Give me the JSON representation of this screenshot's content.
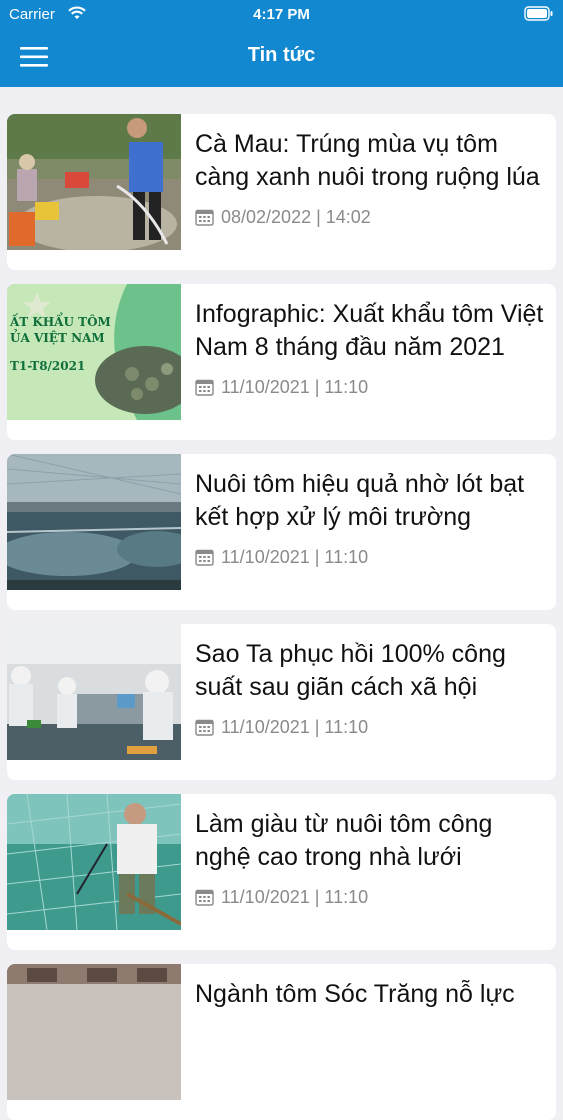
{
  "status_bar": {
    "carrier": "Carrier",
    "time": "4:17 PM"
  },
  "header": {
    "title": "Tin tức"
  },
  "icons": {
    "menu": "hamburger-menu-icon",
    "calendar": "calendar-icon",
    "wifi": "wifi-icon",
    "battery": "battery-icon"
  },
  "colors": {
    "header": "#1188d0",
    "background": "#efeff4",
    "meta_text": "#8a8a8a"
  },
  "articles": [
    {
      "title": "Cà Mau: Trúng mùa vụ tôm càng xanh nuôi trong ruộng lúa",
      "date": "08/02/2022 | 14:02"
    },
    {
      "title": "Infographic: Xuất khẩu tôm Việt Nam 8 tháng đầu năm 2021",
      "date": "11/10/2021 | 11:10"
    },
    {
      "title": "Nuôi tôm hiệu quả nhờ lót bạt kết hợp xử lý môi trường",
      "date": "11/10/2021 | 11:10"
    },
    {
      "title": "Sao Ta phục hồi 100% công suất sau giãn cách xã hội",
      "date": "11/10/2021 | 11:10"
    },
    {
      "title": "Làm giàu từ nuôi tôm công nghệ cao trong nhà lưới",
      "date": "11/10/2021 | 11:10"
    },
    {
      "title": "Ngành tôm Sóc Trăng nỗ lực",
      "date": ""
    }
  ],
  "infographic_image_text": [
    "ẤT KHẨU TÔM",
    "ỦA VIỆT NAM",
    "T1-T8/2021"
  ]
}
